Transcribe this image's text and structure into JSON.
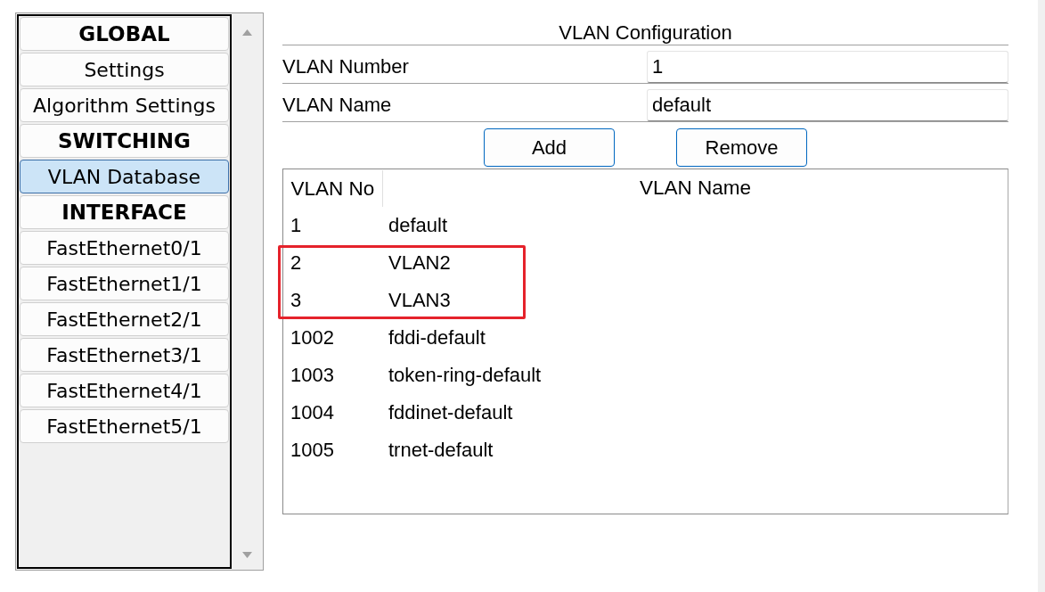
{
  "sidebar": {
    "items": [
      {
        "label": "GLOBAL",
        "kind": "header",
        "selected": false
      },
      {
        "label": "Settings",
        "kind": "item",
        "selected": false
      },
      {
        "label": "Algorithm Settings",
        "kind": "item",
        "selected": false
      },
      {
        "label": "SWITCHING",
        "kind": "header",
        "selected": false
      },
      {
        "label": "VLAN Database",
        "kind": "item",
        "selected": true
      },
      {
        "label": "INTERFACE",
        "kind": "header",
        "selected": false
      },
      {
        "label": "FastEthernet0/1",
        "kind": "item",
        "selected": false
      },
      {
        "label": "FastEthernet1/1",
        "kind": "item",
        "selected": false
      },
      {
        "label": "FastEthernet2/1",
        "kind": "item",
        "selected": false
      },
      {
        "label": "FastEthernet3/1",
        "kind": "item",
        "selected": false
      },
      {
        "label": "FastEthernet4/1",
        "kind": "item",
        "selected": false
      },
      {
        "label": "FastEthernet5/1",
        "kind": "item",
        "selected": false
      }
    ]
  },
  "config": {
    "title": "VLAN Configuration",
    "fields": [
      {
        "label": "VLAN Number",
        "value": "1"
      },
      {
        "label": "VLAN Name",
        "value": "default"
      }
    ],
    "buttons": [
      "Add",
      "Remove"
    ]
  },
  "table": {
    "columns": [
      "VLAN No",
      "VLAN Name"
    ],
    "rows": [
      {
        "cells": [
          "1",
          "default"
        ],
        "highlighted": false
      },
      {
        "cells": [
          "2",
          "VLAN2"
        ],
        "highlighted": true
      },
      {
        "cells": [
          "3",
          "VLAN3"
        ],
        "highlighted": true
      },
      {
        "cells": [
          "1002",
          "fddi-default"
        ],
        "highlighted": false
      },
      {
        "cells": [
          "1003",
          "token-ring-default"
        ],
        "highlighted": false
      },
      {
        "cells": [
          "1004",
          "fddinet-default"
        ],
        "highlighted": false
      },
      {
        "cells": [
          "1005",
          "trnet-default"
        ],
        "highlighted": false
      }
    ]
  }
}
